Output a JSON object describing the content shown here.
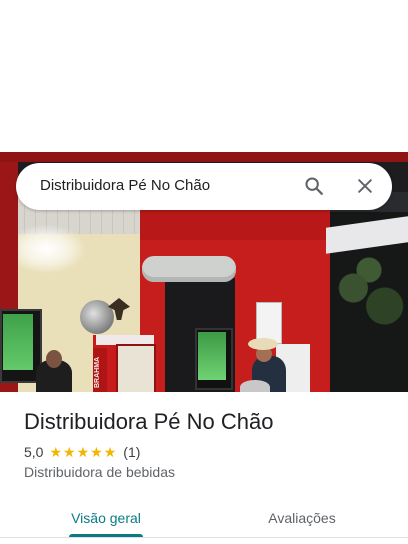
{
  "search": {
    "query": "Distribuidora Pé No Chão",
    "search_icon": "search-icon",
    "close_icon": "close-icon"
  },
  "photo": {
    "sign_text": "BRAHMA"
  },
  "place": {
    "name": "Distribuidora Pé No Chão",
    "rating": "5,0",
    "stars": 5,
    "reviews": "(1)",
    "category": "Distribuidora de bebidas"
  },
  "tabs": [
    {
      "label": "Visão geral",
      "active": true
    },
    {
      "label": "Avaliações",
      "active": false
    }
  ],
  "colors": {
    "accent": "#0b7a86",
    "star": "#f4b400",
    "text_primary": "#202124",
    "text_secondary": "#5f6368"
  }
}
